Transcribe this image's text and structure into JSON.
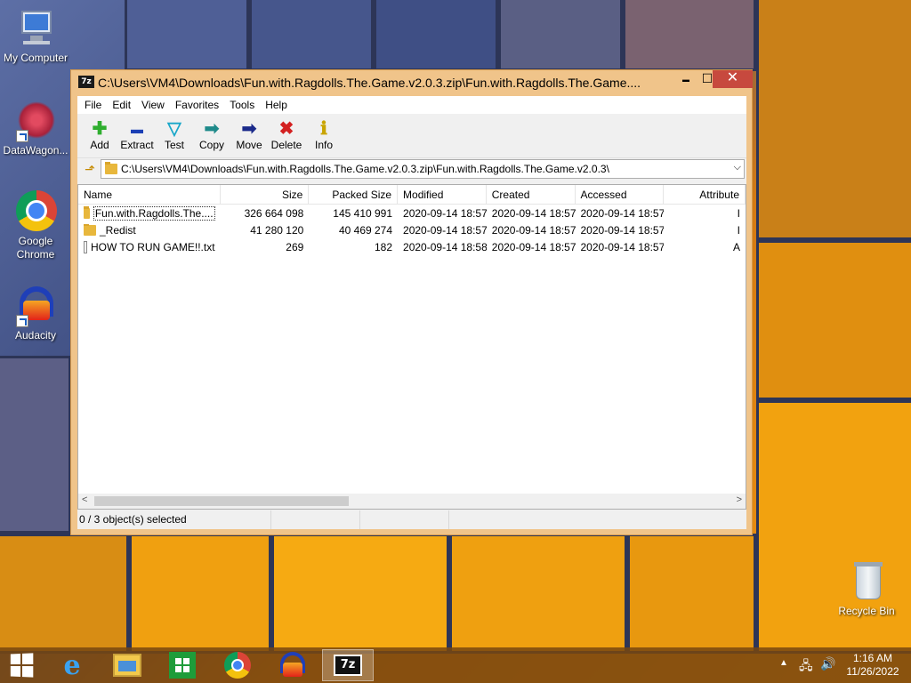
{
  "desktop": {
    "icons": [
      {
        "label": "My Computer"
      },
      {
        "label": "DataWagon..."
      },
      {
        "label": "Google Chrome"
      },
      {
        "label": "Audacity"
      },
      {
        "label": "Recycle Bin"
      }
    ]
  },
  "window": {
    "app_icon": "7z",
    "title": "C:\\Users\\VM4\\Downloads\\Fun.with.Ragdolls.The.Game.v2.0.3.zip\\Fun.with.Ragdolls.The.Game....",
    "minimize": "▬",
    "maximize": "☐",
    "close": "✕"
  },
  "menu": [
    "File",
    "Edit",
    "View",
    "Favorites",
    "Tools",
    "Help"
  ],
  "toolbar": [
    {
      "label": "Add",
      "icon": "plus-icon",
      "glyph": "✚",
      "color": "#2fae2f"
    },
    {
      "label": "Extract",
      "icon": "minus-icon",
      "glyph": "▬",
      "color": "#1b3fb5"
    },
    {
      "label": "Test",
      "icon": "chevron-down-icon",
      "glyph": "▽",
      "color": "#19a7c9"
    },
    {
      "label": "Copy",
      "icon": "copy-arrow-icon",
      "glyph": "➡",
      "color": "#1e8a8a"
    },
    {
      "label": "Move",
      "icon": "move-arrow-icon",
      "glyph": "➡",
      "color": "#1a2a8a"
    },
    {
      "label": "Delete",
      "icon": "delete-x-icon",
      "glyph": "✖",
      "color": "#d32020"
    },
    {
      "label": "Info",
      "icon": "info-icon",
      "glyph": "ℹ",
      "color": "#c9a400"
    }
  ],
  "address": {
    "path": "C:\\Users\\VM4\\Downloads\\Fun.with.Ragdolls.The.Game.v2.0.3.zip\\Fun.with.Ragdolls.The.Game.v2.0.3\\"
  },
  "columns": [
    "Name",
    "Size",
    "Packed Size",
    "Modified",
    "Created",
    "Accessed",
    "Attribute"
  ],
  "rows": [
    {
      "type": "folder",
      "name": "Fun.with.Ragdolls.The....",
      "size": "326 664 098",
      "packed": "145 410 991",
      "modified": "2020-09-14 18:57",
      "created": "2020-09-14 18:57",
      "accessed": "2020-09-14 18:57",
      "attr": "I"
    },
    {
      "type": "folder",
      "name": "_Redist",
      "size": "41 280 120",
      "packed": "40 469 274",
      "modified": "2020-09-14 18:57",
      "created": "2020-09-14 18:57",
      "accessed": "2020-09-14 18:57",
      "attr": "I"
    },
    {
      "type": "file",
      "name": "HOW TO RUN GAME!!.txt",
      "size": "269",
      "packed": "182",
      "modified": "2020-09-14 18:58",
      "created": "2020-09-14 18:57",
      "accessed": "2020-09-14 18:57",
      "attr": "A"
    }
  ],
  "status": {
    "selected": "0 / 3 object(s) selected"
  },
  "taskbar": {
    "clock_time": "1:16 AM",
    "clock_date": "11/26/2022",
    "apps": [
      "start-icon",
      "internet-explorer-icon",
      "file-explorer-icon",
      "store-icon",
      "chrome-icon",
      "audacity-icon",
      "7zip-icon"
    ]
  }
}
